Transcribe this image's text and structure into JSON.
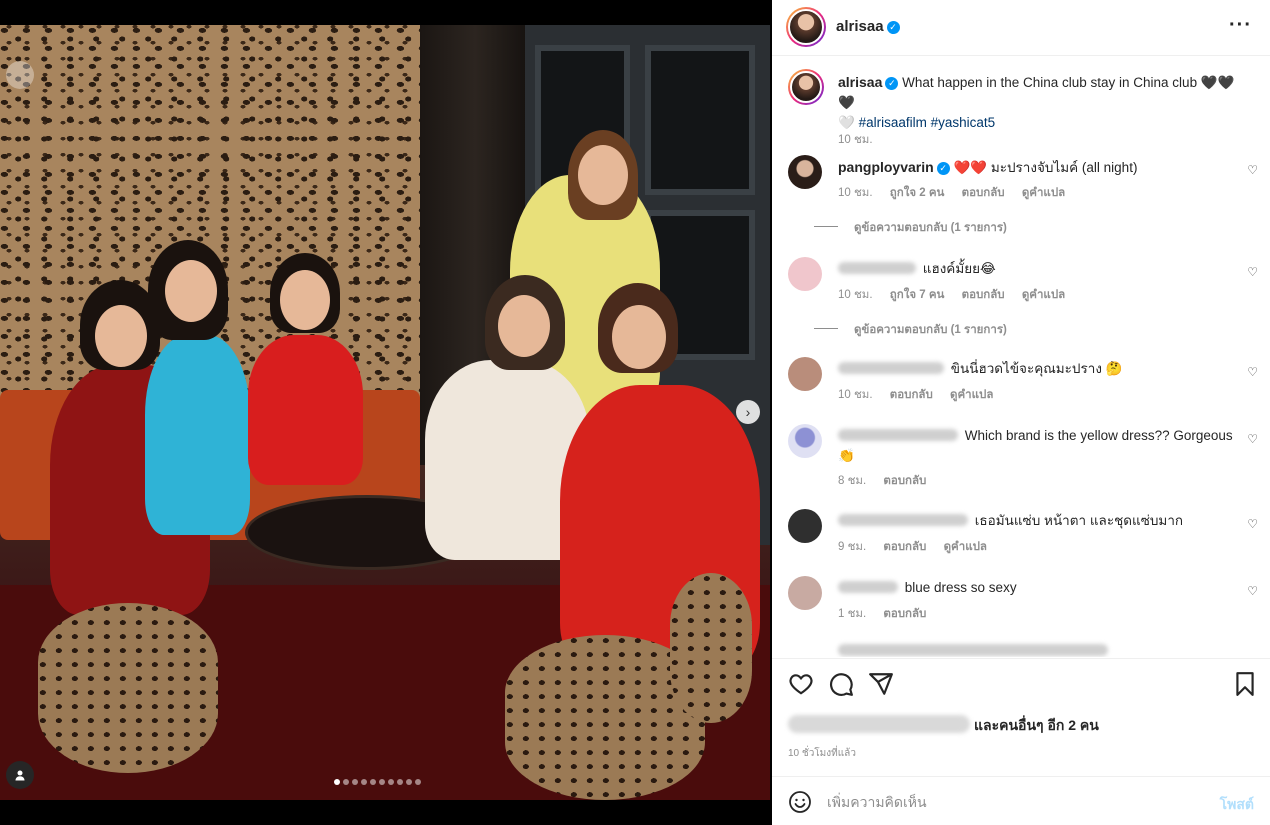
{
  "post": {
    "username": "alrisaa",
    "verified_mark": "✓",
    "more_label": "···",
    "caption": {
      "username": "alrisaa",
      "text": "What happen in the China club stay in China club 🖤🖤🖤",
      "line2_prefix": "🤍",
      "hashtags": "#alrisaafilm #yashicat5",
      "time": "10 ชม."
    }
  },
  "comments": [
    {
      "username": "pangployvarin",
      "verified": true,
      "text": "❤️❤️ มะปรางจับไมค์ (all night)",
      "time": "10 ชม.",
      "likes": "ถูกใจ 2 คน",
      "reply": "ตอบกลับ",
      "translate": "ดูคำแปล",
      "view_replies": "ดูข้อความตอบกลับ (1 รายการ)",
      "avatar_color": "#3a2a24"
    },
    {
      "username": "",
      "text": "แฮงค์มั้ยย😂",
      "time": "10 ชม.",
      "likes": "ถูกใจ 7 คน",
      "reply": "ตอบกลับ",
      "translate": "ดูคำแปล",
      "view_replies": "ดูข้อความตอบกลับ (1 รายการ)",
      "avatar_color": "#e8b7c0"
    },
    {
      "username": "",
      "text": "ขินนี่ฮวดไข้จะคุณมะปราง 🤔",
      "time": "10 ชม.",
      "reply": "ตอบกลับ",
      "translate": "ดูคำแปล",
      "avatar_color": "#b08a78"
    },
    {
      "username": "",
      "text": "Which brand is the yellow dress?? Gorgeous 👏",
      "time": "8 ชม.",
      "reply": "ตอบกลับ",
      "avatar_color": "#7b7fc4"
    },
    {
      "username": "",
      "text": "เธอมันแซ่บ หน้าตา และชุดแซ่บมาก",
      "time": "9 ชม.",
      "reply": "ตอบกลับ",
      "translate": "ดูคำแปล",
      "avatar_color": "#3b3b3b"
    },
    {
      "username": "",
      "text": "blue dress so sexy",
      "time": "1 ชม.",
      "reply": "ตอบกลับ",
      "avatar_color": "#c8a9a0"
    }
  ],
  "actions": {
    "likes_text": "และคนอื่นๆ อีก 2 คน",
    "timestamp": "10 ชั่วโมงที่แล้ว"
  },
  "composer": {
    "placeholder": "เพิ่มความคิดเห็น",
    "post_label": "โพสต์"
  },
  "media": {
    "carousel_next": "›",
    "total_slides": 10,
    "current_slide": 1,
    "user_tag_icon": "person-icon"
  }
}
